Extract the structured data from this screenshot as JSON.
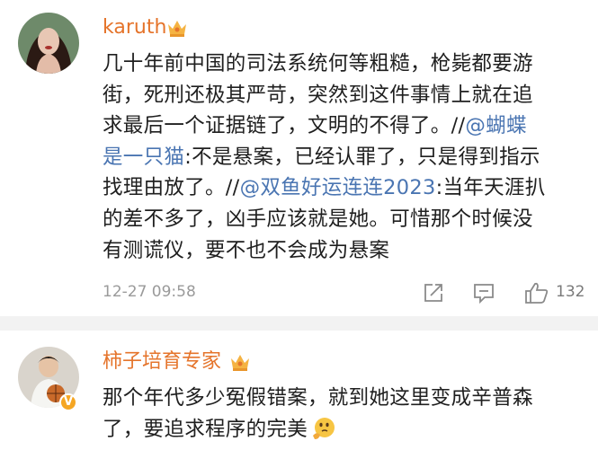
{
  "comments": [
    {
      "username": "karuth",
      "text_lines": [
        "几十年前中国的司法系统何等粗糙，枪毙都要游",
        "街，死刑还极其严苛，突然到这件事情上就在追",
        "求最后一个证据链了，文明的不得了。//",
        "@蝴蝶",
        "是一只猫",
        ":不是悬案，已经认罪了，只是得到指示",
        "找理由放了。//",
        "@双鱼好运连连2023",
        ":当年天涯扒",
        "的差不多了，凶手应该就是她。可惜那个时候没",
        "有测谎仪，要不也不会成为悬案"
      ],
      "time": "12-27 09:58",
      "like_count": "132",
      "icons": [
        "crown-badge-icon",
        "share-icon",
        "comment-icon",
        "like-icon"
      ],
      "accent": "#e5742b",
      "link_color": "#4a75b2"
    },
    {
      "username": "柿子培育专家",
      "verified_badge": "V",
      "text_lines": [
        "那个年代多少冤假错案，就到她这里变成辛普森",
        "了，要追求程序的完美"
      ],
      "icons": [
        "crown-badge-icon",
        "verified-icon",
        "thinking-emoji-icon"
      ]
    }
  ]
}
